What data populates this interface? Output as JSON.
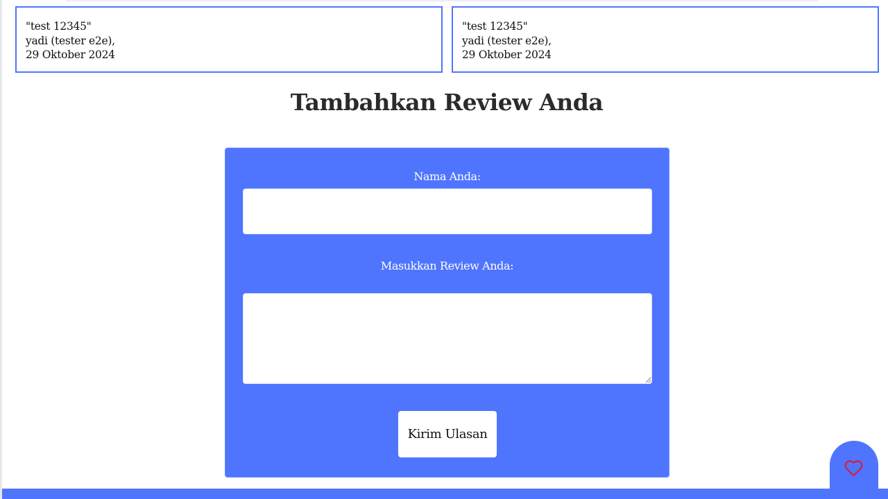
{
  "reviews": [
    {
      "text": "\"test 12345\"",
      "author": "yadi (tester e2e),",
      "date": "29 Oktober 2024"
    },
    {
      "text": "\"test 12345\"",
      "author": "yadi (tester e2e),",
      "date": "29 Oktober 2024"
    }
  ],
  "form": {
    "title": "Tambahkan Review Anda",
    "name_label": "Nama Anda:",
    "name_value": "",
    "review_label": "Masukkan Review Anda:",
    "review_value": "",
    "submit_label": "Kirim Ulasan"
  },
  "colors": {
    "accent": "#4f75ff",
    "heart": "#e0182d",
    "title_text": "#2b2b2b"
  },
  "icons": {
    "favorite": "heart-icon"
  }
}
